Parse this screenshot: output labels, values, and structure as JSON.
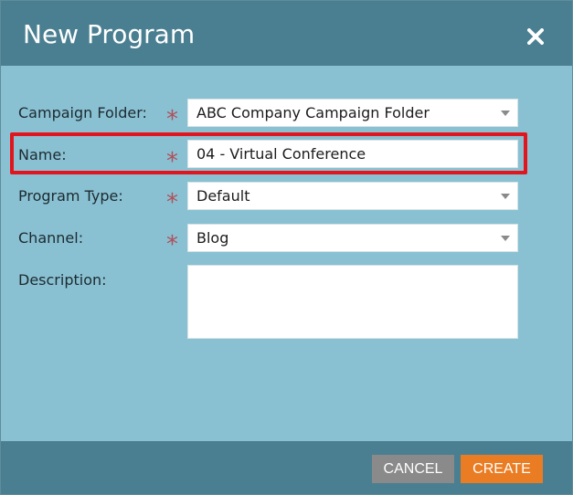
{
  "dialog": {
    "title": "New Program"
  },
  "form": {
    "campaign_folder": {
      "label": "Campaign Folder:",
      "required_mark": "*",
      "value": "ABC Company Campaign Folder"
    },
    "name": {
      "label": "Name:",
      "required_mark": "*",
      "value": "04 - Virtual Conference"
    },
    "program_type": {
      "label": "Program Type:",
      "required_mark": "*",
      "value": "Default"
    },
    "channel": {
      "label": "Channel:",
      "required_mark": "*",
      "value": "Blog"
    },
    "description": {
      "label": "Description:",
      "value": ""
    }
  },
  "buttons": {
    "cancel": "CANCEL",
    "create": "CREATE"
  },
  "colors": {
    "title_bar": "#4a7f91",
    "body_bg": "#89c1d3",
    "required_asterisk": "#b0505a",
    "highlight": "#e0151d",
    "cancel_bg": "#8a8a8a",
    "create_bg": "#ea7d24"
  },
  "icons": {
    "close": "close-icon",
    "dropdown": "chevron-down-icon"
  }
}
